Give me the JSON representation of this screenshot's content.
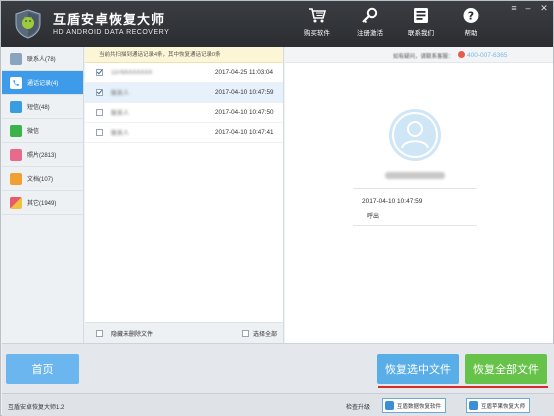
{
  "header": {
    "title_cn": "互盾安卓恢复大师",
    "title_en": "HD ANDROID DATA RECOVERY",
    "tools": [
      {
        "label": "购买软件",
        "icon": "cart-icon"
      },
      {
        "label": "注册激活",
        "icon": "key-icon"
      },
      {
        "label": "联系我们",
        "icon": "contact-card-icon"
      },
      {
        "label": "帮助",
        "icon": "help-icon"
      }
    ],
    "window_controls": {
      "menu": "≡",
      "minimize": "–",
      "close": "✕"
    }
  },
  "sidebar": {
    "items": [
      {
        "label": "联系人(78)",
        "icon": "contacts-icon",
        "color": "#8aa4c0",
        "active": false
      },
      {
        "label": "通话记录(4)",
        "icon": "call-log-icon",
        "color": "#ffffff",
        "active": true
      },
      {
        "label": "短信(48)",
        "icon": "sms-icon",
        "color": "#3a9de0",
        "active": false
      },
      {
        "label": "微信",
        "icon": "wechat-icon",
        "color": "#3bb34a",
        "active": false
      },
      {
        "label": "照片(2813)",
        "icon": "photo-icon",
        "color": "#e86a8a",
        "active": false
      },
      {
        "label": "文档(107)",
        "icon": "document-icon",
        "color": "#f0a030",
        "active": false
      },
      {
        "label": "其它(1949)",
        "icon": "other-files-icon",
        "color": "#e85a6a",
        "active": false
      }
    ]
  },
  "list": {
    "info": "当前共扫描到通话记录4条，其中恢复通话记录0条",
    "rows": [
      {
        "name": "1376XXXXXXX",
        "time": "2017-04-25 11:03:04",
        "checked": true,
        "selected": false
      },
      {
        "name": "联系人",
        "time": "2017-04-10 10:47:59",
        "checked": true,
        "selected": true
      },
      {
        "name": "联系人",
        "time": "2017-04-10 10:47:50",
        "checked": false,
        "selected": false
      },
      {
        "name": "联系人",
        "time": "2017-04-10 10:47:41",
        "checked": false,
        "selected": false
      }
    ],
    "footer": {
      "hide_deleted": "隐藏未删除文件",
      "select_all": "选择全部"
    }
  },
  "detail": {
    "contact_text": "如有疑问，请联系客服：",
    "phone": "400-007-6365",
    "call_time": "2017-04-10 10:47:59",
    "call_type": "呼出"
  },
  "actions": {
    "home": "首页",
    "recover_selected": "恢复选中文件",
    "recover_all": "恢复全部文件"
  },
  "status": {
    "version": "互盾安卓恢复大师1.2",
    "check_update": "检查升级",
    "promo_1": "互盾数据恢复软件",
    "promo_2": "互盾苹果恢复大师"
  }
}
